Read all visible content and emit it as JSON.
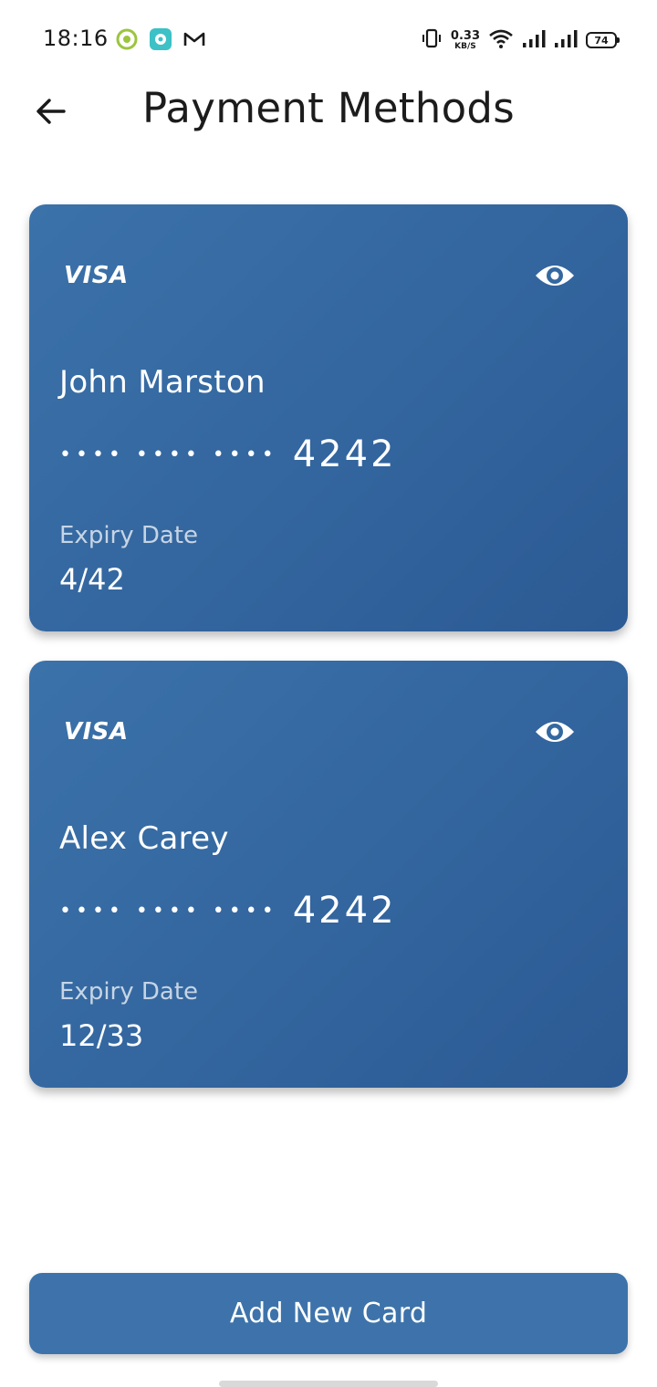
{
  "status_bar": {
    "time": "18:16",
    "net_speed": "0.33",
    "net_speed_unit": "KB/S",
    "battery": "74",
    "notification_icons": [
      "location-ring-icon",
      "chat-app-icon",
      "gmail-icon"
    ],
    "system_icons": [
      "vibrate-icon",
      "wifi-icon",
      "signal-icon",
      "signal-icon",
      "battery-icon"
    ]
  },
  "header": {
    "title": "Payment Methods",
    "back_icon": "arrow-left-icon"
  },
  "cards": [
    {
      "brand": "VISA",
      "holder": "John Marston",
      "masked": "•••• •••• ••••",
      "last4": "4242",
      "expiry_label": "Expiry Date",
      "expiry": "4/42",
      "eye_icon": "eye-icon"
    },
    {
      "brand": "VISA",
      "holder": "Alex Carey",
      "masked": "•••• •••• ••••",
      "last4": "4242",
      "expiry_label": "Expiry Date",
      "expiry": "12/33",
      "eye_icon": "eye-icon"
    }
  ],
  "actions": {
    "add_card_label": "Add New Card"
  },
  "colors": {
    "card_gradient_start": "#3b72a9",
    "card_gradient_end": "#2c5a93",
    "button": "#3d73aa",
    "text_dark": "#1c1c1c",
    "background": "#ffffff"
  }
}
